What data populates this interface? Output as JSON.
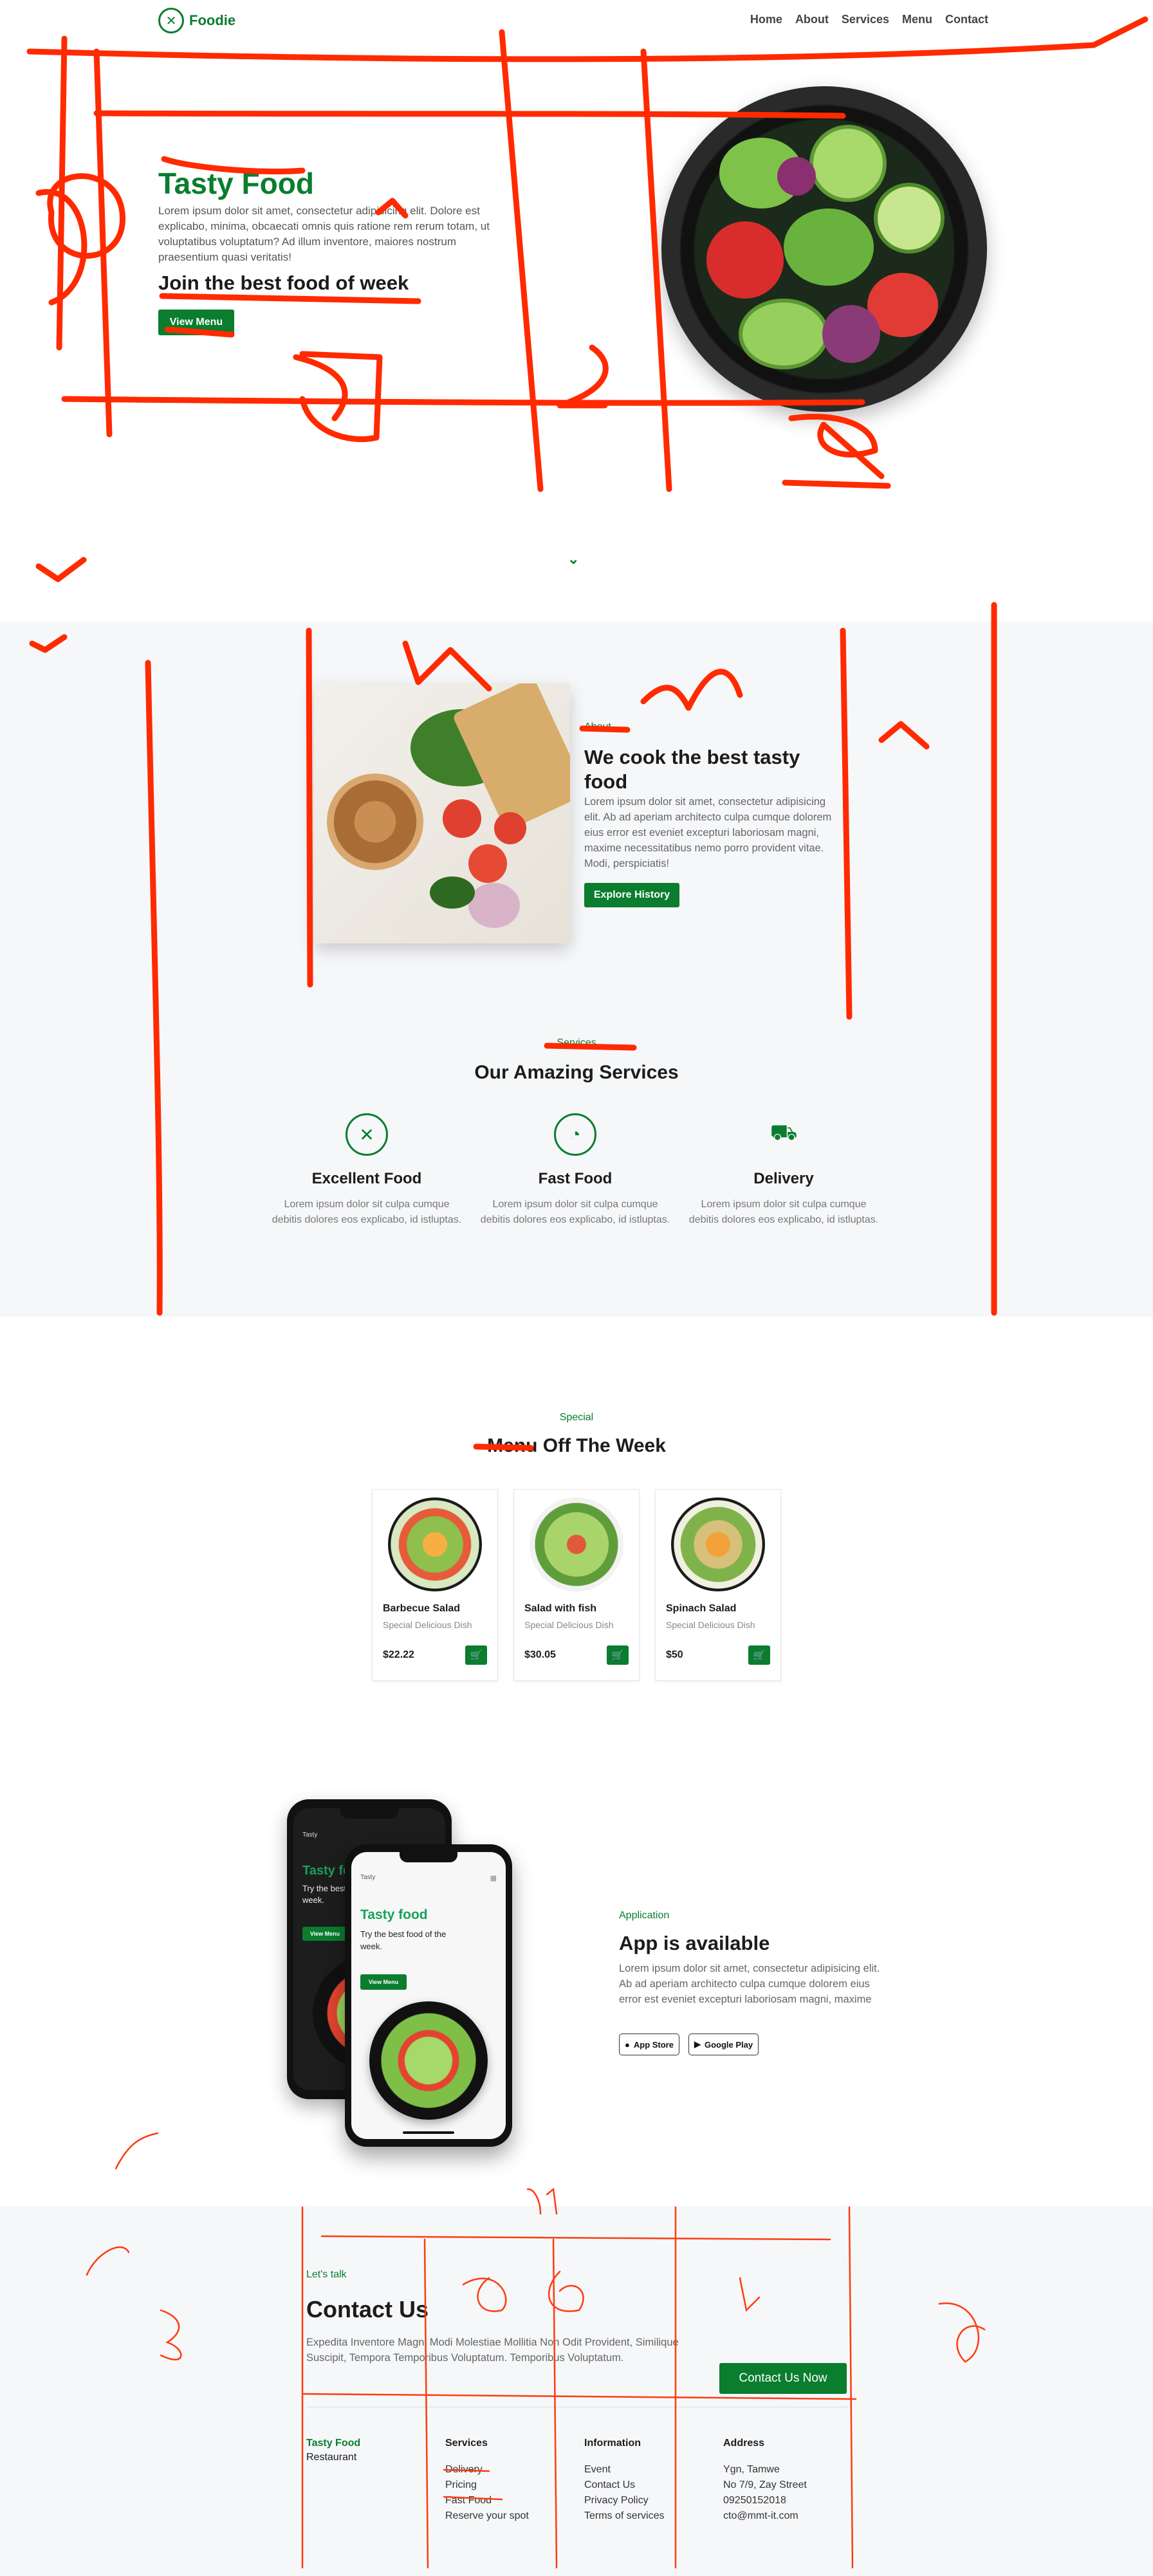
{
  "header": {
    "brand": "Foodie",
    "nav": [
      "Home",
      "About",
      "Services",
      "Menu",
      "Contact"
    ]
  },
  "hero": {
    "title": "Tasty Food",
    "text": "Lorem ipsum dolor sit amet, consectetur adipisicing elit. Dolore est explicabo, minima, obcaecati omnis quis ratione rem rerum totam, ut voluptatibus voluptatum? Ad illum inventore, maiores nostrum praesentium quasi veritatis!",
    "subtitle": "Join the best food of week",
    "button": "View Menu"
  },
  "about": {
    "label": "About",
    "title": "We cook the best tasty food",
    "text": "Lorem ipsum dolor sit amet, consectetur adipisicing elit. Ab ad aperiam architecto culpa cumque dolorem eius error est eveniet excepturi laboriosam magni, maxime necessitatibus nemo porro provident vitae. Modi, perspiciatis!",
    "button": "Explore History"
  },
  "services": {
    "label": "Services",
    "title": "Our Amazing Services",
    "items": [
      {
        "name": "Excellent Food",
        "desc": "Lorem ipsum dolor sit culpa cumque debitis dolores eos explicabo, id istluptas.",
        "icon": "fork-knife-icon"
      },
      {
        "name": "Fast Food",
        "desc": "Lorem ipsum dolor sit culpa cumque debitis dolores eos explicabo, id istluptas.",
        "icon": "pizza-icon"
      },
      {
        "name": "Delivery",
        "desc": "Lorem ipsum dolor sit culpa cumque debitis dolores eos explicabo, id istluptas.",
        "icon": "delivery-truck-icon"
      }
    ]
  },
  "menu": {
    "label": "Special",
    "title": "Menu Off The Week",
    "items": [
      {
        "name": "Barbecue Salad",
        "sub": "Special Delicious Dish",
        "price": "$22.22"
      },
      {
        "name": "Salad with fish",
        "sub": "Special Delicious Dish",
        "price": "$30.05"
      },
      {
        "name": "Spinach Salad",
        "sub": "Special Delicious Dish",
        "price": "$50"
      }
    ]
  },
  "app": {
    "label": "Application",
    "title": "App is available",
    "text": "Lorem ipsum dolor sit amet, consectetur adipisicing elit. Ab ad aperiam architecto culpa cumque dolorem eius error est eveniet excepturi laboriosam magni, maxime",
    "app_store": "App Store",
    "google_play": "Google Play",
    "phone": {
      "brand": "Tasty",
      "title": "Tasty food",
      "text": "Try the best food of the week.",
      "button": "View Menu"
    }
  },
  "contact": {
    "label": "Let's talk",
    "title": "Contact Us",
    "text": "Expedita Inventore Magni Modi Molestiae Mollitia Non Odit Provident, Similique Suscipit, Tempora Temporibus Voluptatum. Temporibus Voluptatum.",
    "button": "Contact Us Now"
  },
  "footer": {
    "brand_name": "Tasty Food",
    "brand_sub": "Restaurant",
    "services_title": "Services",
    "services": [
      "Delivery",
      "Pricing",
      "Fast Food",
      "Reserve your spot"
    ],
    "info_title": "Information",
    "info": [
      "Event",
      "Contact Us",
      "Privacy Policy",
      "Terms of services"
    ],
    "address_title": "Address",
    "address": [
      "Ygn, Tamwe",
      "No 7/9, Zay Street",
      "09250152018",
      "cto@mmt-it.com"
    ]
  },
  "colors": {
    "accent": "#0a7d2e",
    "band": "#f6f7f9",
    "annotation": "#ff2a00"
  }
}
